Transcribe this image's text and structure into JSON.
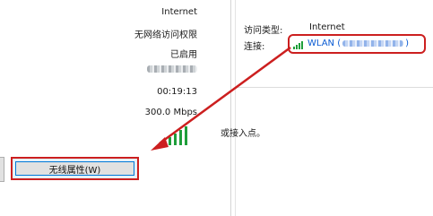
{
  "left_panel": {
    "values": {
      "ipv4_connectivity": "Internet",
      "ipv6_connectivity": "无网络访问权限",
      "media_state": "已启用",
      "duration": "00:19:13",
      "speed": "300.0 Mbps"
    },
    "wireless_properties_button": "无线属性(W)"
  },
  "right_panel": {
    "access_type_label": "访问类型:",
    "access_type_value": "Internet",
    "connection_label": "连接:",
    "wlan_link_text": "WLAN (",
    "wlan_link_close": ")",
    "partial_text": "或接入点。"
  },
  "colors": {
    "highlight_red": "#cc1f1f",
    "link_blue": "#0a5bd3",
    "signal_green": "#1e9e3a"
  }
}
